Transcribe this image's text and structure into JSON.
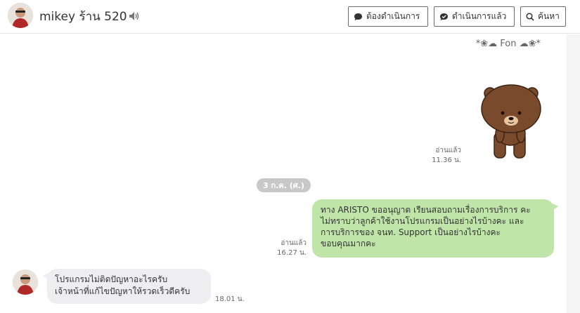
{
  "header": {
    "contact_name": "mikey ร้าน 520",
    "speaker_icon": "speaker-icon",
    "buttons": [
      {
        "label": "ต้องดำเนินการ",
        "icon": "chat-bubble-icon"
      },
      {
        "label": "ดำเนินการแล้ว",
        "icon": "check-bubble-icon"
      },
      {
        "label": "ค้นหา",
        "icon": "search-icon"
      }
    ]
  },
  "chat": {
    "sender_display": "*❀☁ Fon ☁❀*",
    "sticker": {
      "icon": "brown-bear-sticker",
      "read_status": "อ่านแล้ว",
      "time": "11.36 น."
    },
    "date_divider": "3 ก.ค. (ศ.)",
    "outgoing_message": {
      "lines": [
        "ทาง ARISTO ขออนุญาต เรียนสอบถามเรื่องการบริการ คะ",
        "ไม่ทราบว่าลูกค้าใช้งานโปรแกรมเป็นอย่างไรบ้างคะ และ",
        "การบริการของ จนท. Support เป็นอย่างไรบ้างคะ",
        "ขอบคุณมากคะ"
      ],
      "read_status": "อ่านแล้ว",
      "time": "16.27 น."
    },
    "incoming_message": {
      "lines": [
        "โปรแกรมไม่ติดปัญหาอะไรครับ",
        "เจ้าหน้าที่แก้ไขปัญหาให้รวดเร็วดีครับ"
      ],
      "time": "18.01 น."
    }
  },
  "colors": {
    "outgoing_bubble": "#bfe5a9",
    "incoming_bubble": "#eeeef1",
    "date_pill": "#c8c8c8"
  }
}
